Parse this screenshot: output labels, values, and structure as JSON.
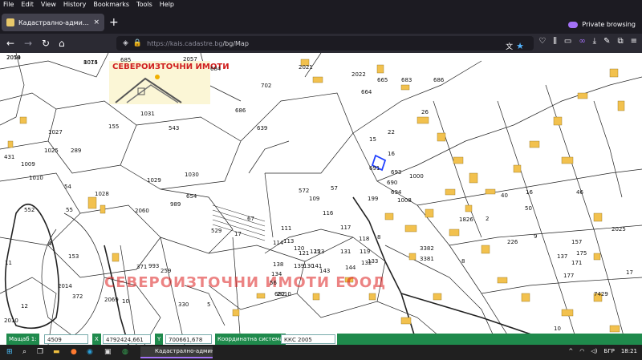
{
  "menu": [
    "File",
    "Edit",
    "View",
    "History",
    "Bookmarks",
    "Tools",
    "Help"
  ],
  "tab": {
    "title": "Кадастрално-административна...",
    "close": "×"
  },
  "newtab": "+",
  "private_label": "Private browsing",
  "url": {
    "host": "https://kais.cadastre.bg",
    "path": "/bg/Map"
  },
  "logo_text": "СЕВЕРОИЗТОЧНИ ИМОТИ",
  "watermark_text": "СЕВЕРОИЗТОЧНИ ИМОТИ ЕООД",
  "map_labels": [
    "2014",
    "1014",
    "685",
    "2057",
    "702",
    "684",
    "686",
    "664",
    "665",
    "683",
    "686",
    "26",
    "2021",
    "2022",
    "1027",
    "1025",
    "1031",
    "543",
    "289",
    "155",
    "639",
    "15",
    "691",
    "22",
    "16",
    "690",
    "1000",
    "693",
    "694",
    "1008",
    "199",
    "2060",
    "572",
    "109",
    "57",
    "116",
    "117",
    "118",
    "119",
    "8",
    "2010",
    "431",
    "1009",
    "1010",
    "54",
    "552",
    "55",
    "1028",
    "1029",
    "1030",
    "654",
    "989",
    "529",
    "17",
    "67",
    "111",
    "113",
    "114",
    "120",
    "121",
    "125",
    "123",
    "131",
    "138",
    "139",
    "130",
    "141",
    "143",
    "144",
    "132",
    "133",
    "134",
    "56",
    "682",
    "4",
    "11",
    "153",
    "2014",
    "12",
    "372",
    "2069",
    "10",
    "371",
    "993",
    "259",
    "330",
    "5",
    "2010",
    "3381",
    "3382",
    "1826",
    "2",
    "226",
    "9",
    "157",
    "175",
    "137",
    "171",
    "177",
    "7429",
    "2025",
    "8",
    "40",
    "16",
    "50",
    "46",
    "17",
    "10",
    "7059",
    "8075"
  ],
  "coords": {
    "scale_label": "Мащаб 1:",
    "scale_value": "4509",
    "x_label": "X",
    "x_value": "4792424,661",
    "y_label": "Y",
    "y_value": "700661,678",
    "system_label": "Координатна система",
    "system_value": "ККС 2005"
  },
  "taskbar": {
    "app_title": "Кадастрално-админ...",
    "lang": "БГР",
    "time": "18:21"
  },
  "colors": {
    "building": "#f2c14e",
    "accent": "#a371f7",
    "coordbar": "#1f8a4c"
  }
}
